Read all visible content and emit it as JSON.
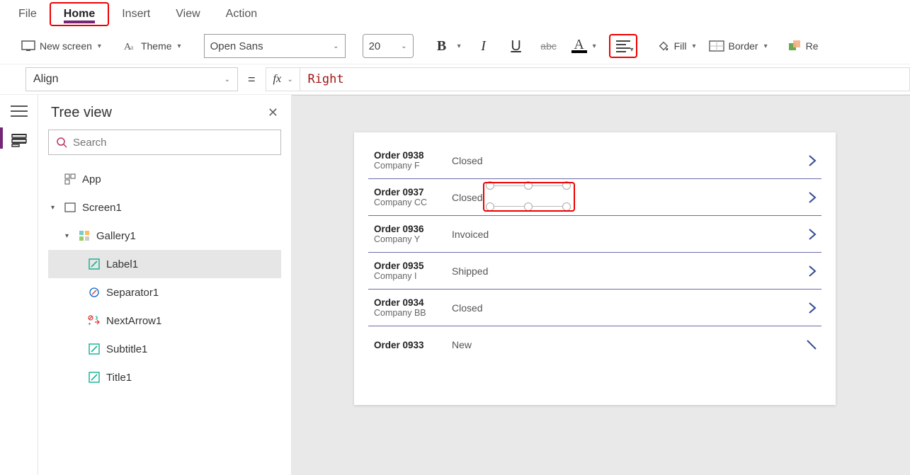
{
  "ribbon": {
    "tabs": [
      "File",
      "Home",
      "Insert",
      "View",
      "Action"
    ],
    "active": "Home"
  },
  "toolbar": {
    "new_screen": "New screen",
    "theme": "Theme",
    "font_family": "Open Sans",
    "font_size": "20",
    "fill": "Fill",
    "border": "Border",
    "reorder": "Re"
  },
  "formula": {
    "property": "Align",
    "fx": "fx",
    "value": "Right"
  },
  "tree": {
    "title": "Tree view",
    "search_placeholder": "Search",
    "items": {
      "app": "App",
      "screen": "Screen1",
      "gallery": "Gallery1",
      "label": "Label1",
      "separator": "Separator1",
      "nextarrow": "NextArrow1",
      "subtitle": "Subtitle1",
      "titlectl": "Title1"
    }
  },
  "gallery": [
    {
      "order": "Order 0938",
      "company": "Company F",
      "status": "Closed"
    },
    {
      "order": "Order 0937",
      "company": "Company CC",
      "status": "Closed"
    },
    {
      "order": "Order 0936",
      "company": "Company Y",
      "status": "Invoiced"
    },
    {
      "order": "Order 0935",
      "company": "Company I",
      "status": "Shipped"
    },
    {
      "order": "Order 0934",
      "company": "Company BB",
      "status": "Closed"
    },
    {
      "order": "Order 0933",
      "company": "",
      "status": "New"
    }
  ],
  "highlight_boxes": [
    "home-tab",
    "font-size",
    "align-button",
    "label1-status"
  ]
}
